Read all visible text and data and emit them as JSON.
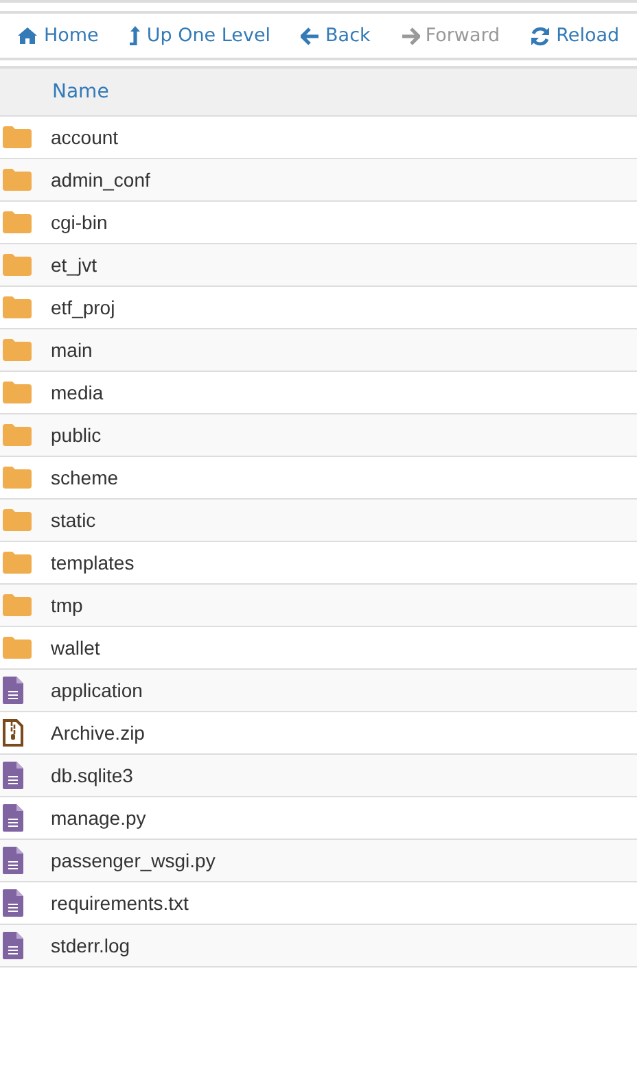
{
  "toolbar": [
    {
      "kind": "home",
      "label": "Home",
      "disabled": false
    },
    {
      "kind": "up",
      "label": "Up One Level",
      "disabled": false
    },
    {
      "kind": "back",
      "label": "Back",
      "disabled": false
    },
    {
      "kind": "forward",
      "label": "Forward",
      "disabled": true
    },
    {
      "kind": "reload",
      "label": "Reload",
      "disabled": false
    }
  ],
  "table": {
    "columns": [
      "Name"
    ],
    "rows": [
      {
        "kind": "folder",
        "name": "account"
      },
      {
        "kind": "folder",
        "name": "admin_conf"
      },
      {
        "kind": "folder",
        "name": "cgi-bin"
      },
      {
        "kind": "folder",
        "name": "et_jvt"
      },
      {
        "kind": "folder",
        "name": "etf_proj"
      },
      {
        "kind": "folder",
        "name": "main"
      },
      {
        "kind": "folder",
        "name": "media"
      },
      {
        "kind": "folder",
        "name": "public"
      },
      {
        "kind": "folder",
        "name": "scheme"
      },
      {
        "kind": "folder",
        "name": "static"
      },
      {
        "kind": "folder",
        "name": "templates"
      },
      {
        "kind": "folder",
        "name": "tmp"
      },
      {
        "kind": "folder",
        "name": "wallet"
      },
      {
        "kind": "file",
        "name": "application"
      },
      {
        "kind": "archive",
        "name": "Archive.zip"
      },
      {
        "kind": "file",
        "name": "db.sqlite3"
      },
      {
        "kind": "file",
        "name": "manage.py"
      },
      {
        "kind": "file",
        "name": "passenger_wsgi.py"
      },
      {
        "kind": "file",
        "name": "requirements.txt"
      },
      {
        "kind": "file",
        "name": "stderr.log"
      }
    ]
  }
}
